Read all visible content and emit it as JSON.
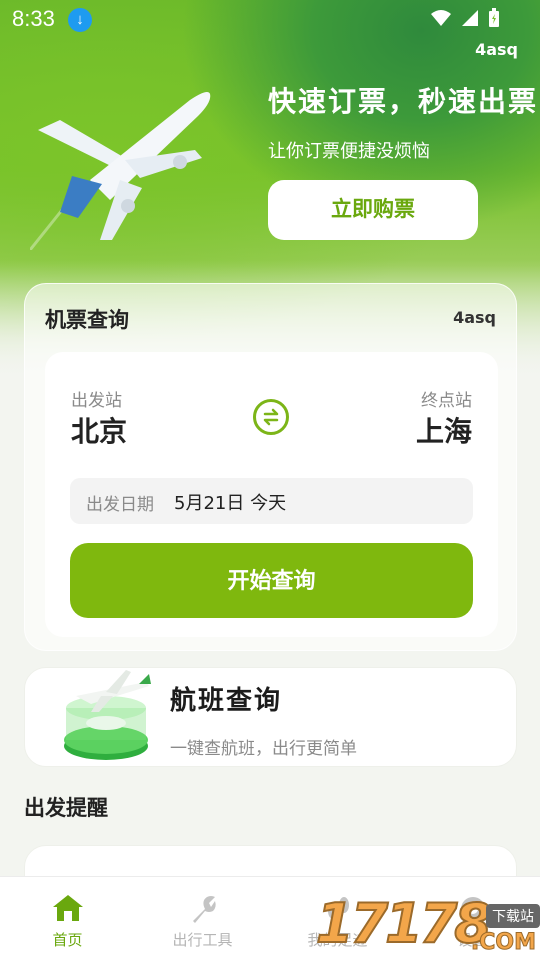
{
  "status": {
    "time": "8:33"
  },
  "hero": {
    "tag": "4asq",
    "headline": "快速订票，秒速出票",
    "subline": "让你订票便捷没烦恼",
    "buy_label": "立即购票"
  },
  "query": {
    "title": "机票查询",
    "tag": "4asq",
    "from_label": "出发站",
    "from_city": "北京",
    "to_label": "终点站",
    "to_city": "上海",
    "date_label": "出发日期",
    "date_value": "5月21日 今天",
    "search_label": "开始查询"
  },
  "flight": {
    "title": "航班查询",
    "subtitle": "一键查航班，出行更简单"
  },
  "reminder": {
    "title": "出发提醒"
  },
  "tabs": [
    {
      "label": "首页",
      "icon": "home-icon"
    },
    {
      "label": "出行工具",
      "icon": "wrench-icon"
    },
    {
      "label": "我的足迹",
      "icon": "footprint-icon"
    },
    {
      "label": "设置",
      "icon": "settings-icon"
    }
  ],
  "watermark": {
    "number": "17178",
    "tag": "下载站",
    "suffix": ".COM"
  },
  "colors": {
    "accent": "#7fb80e",
    "accent_text": "#6aa80e",
    "hero_green": "#77c02c"
  }
}
